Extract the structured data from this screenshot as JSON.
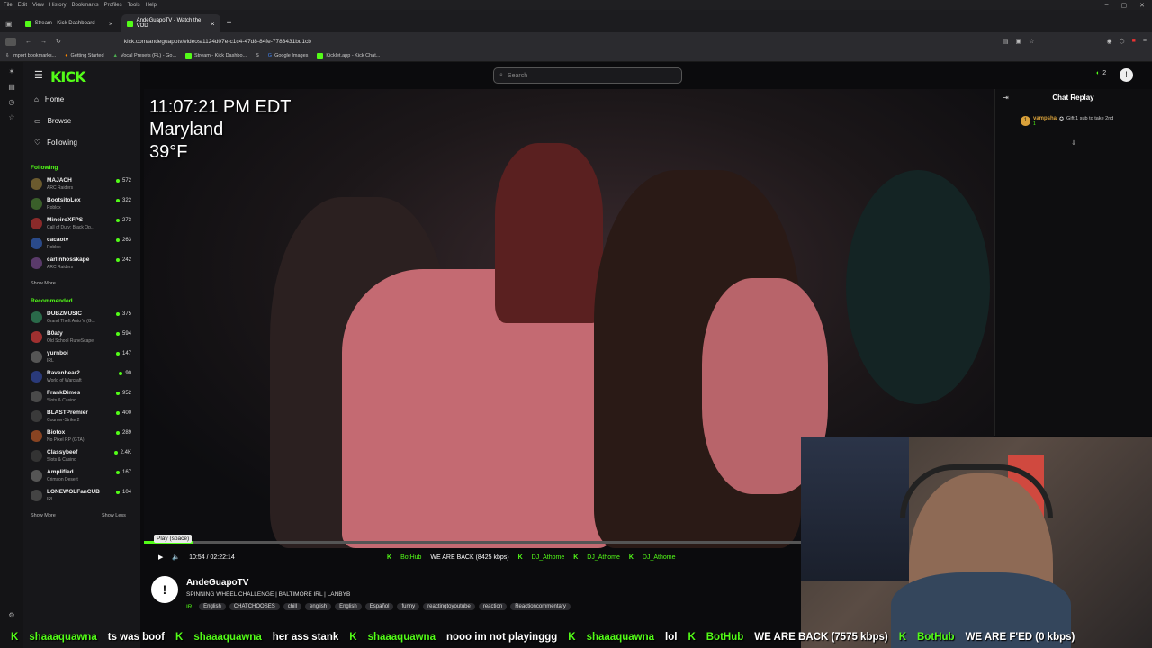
{
  "browser": {
    "menu": [
      "File",
      "Edit",
      "View",
      "History",
      "Bookmarks",
      "Profiles",
      "Tools",
      "Help"
    ],
    "tabs": [
      {
        "label": "Stream - Kick Dashboard"
      },
      {
        "label": "AndeGuapoTV - Watch the VOD"
      }
    ],
    "url": "kick.com/andeguapotv/videos/1124d07e-c1c4-47d8-84fe-7783431bd1cb",
    "bookmarks": [
      "Import bookmarks...",
      "Getting Started",
      "Vocal Presets (FL) - Go...",
      "Stream - Kick Dashbo...",
      "Google Images",
      "Kicklet.app - Kick Chat..."
    ]
  },
  "site": {
    "logo": "KICK",
    "search_placeholder": "Search",
    "notif_count": "2"
  },
  "nav": {
    "home": "Home",
    "browse": "Browse",
    "following": "Following"
  },
  "following": {
    "heading": "Following",
    "channels": [
      {
        "name": "MAJACH",
        "game": "ARC Raiders",
        "viewers": "572"
      },
      {
        "name": "BootsitoLex",
        "game": "Roblox",
        "viewers": "322"
      },
      {
        "name": "MineiroXFPS",
        "game": "Call of Duty: Black Op...",
        "viewers": "273"
      },
      {
        "name": "cacaotv",
        "game": "Roblox",
        "viewers": "263"
      },
      {
        "name": "carlinhosskape",
        "game": "ARC Raiders",
        "viewers": "242"
      }
    ],
    "show_more": "Show More"
  },
  "recommended": {
    "heading": "Recommended",
    "channels": [
      {
        "name": "DUBZMUSIC",
        "game": "Grand Theft Auto V (G...",
        "viewers": "375"
      },
      {
        "name": "B0aty",
        "game": "Old School RuneScape",
        "viewers": "594"
      },
      {
        "name": "yurnboi",
        "game": "IRL",
        "viewers": "147"
      },
      {
        "name": "Ravenbear2",
        "game": "World of Warcraft",
        "viewers": "90"
      },
      {
        "name": "FrankDimes",
        "game": "Slots & Casino",
        "viewers": "952"
      },
      {
        "name": "BLASTPremier",
        "game": "Counter-Strike 2",
        "viewers": "400"
      },
      {
        "name": "Biotox",
        "game": "No Pixel RP (GTA)",
        "viewers": "289"
      },
      {
        "name": "Classybeef",
        "game": "Slots & Casino",
        "viewers": "2.4K"
      },
      {
        "name": "Amplified",
        "game": "Crimson Desert",
        "viewers": "167"
      },
      {
        "name": "LONEWOLFanCUB",
        "game": "IRL",
        "viewers": "104"
      }
    ],
    "show_more": "Show More",
    "show_less": "Show Less"
  },
  "video": {
    "overlay_time": "11:07:21 PM EDT",
    "overlay_location": "Maryland",
    "overlay_temp": "39°F",
    "tooltip": "Play (space)",
    "time": "10:54 / 02:22:14",
    "progress_fraction": 0.076
  },
  "ticker_small": [
    {
      "user": "BotHub",
      "msg": "WE ARE BACK (8425 kbps)"
    },
    {
      "user": "DJ_Athome",
      "msg": ""
    },
    {
      "user": "DJ_Athome",
      "msg": ""
    },
    {
      "user": "DJ_Athome",
      "msg": ""
    }
  ],
  "channel": {
    "name": "AndeGuapoTV",
    "title": "SPINNING WHEEL CHALLENGE | BALTIMORE IRL | LANBYB",
    "category": "IRL",
    "tags": [
      "English",
      "CHATCHOOSES",
      "chill",
      "english",
      "English",
      "Español",
      "funny",
      "reactingtoyoutube",
      "reaction",
      "Reactioncommentary"
    ]
  },
  "chat": {
    "title": "Chat Replay",
    "message": {
      "user": "vampsha",
      "count": "1",
      "text": "Gift 1 sub to take 2nd"
    }
  },
  "ticker_big": [
    {
      "user": "shaaaquawna",
      "msg": "ts was boof"
    },
    {
      "user": "shaaaquawna",
      "msg": "her ass stank"
    },
    {
      "user": "shaaaquawna",
      "msg": "nooo im not playinggg"
    },
    {
      "user": "shaaaquawna",
      "msg": "lol"
    },
    {
      "user": "BotHub",
      "msg": "WE ARE BACK (7575 kbps)"
    },
    {
      "user": "BotHub",
      "msg": "WE ARE F'ED (0 kbps)"
    }
  ],
  "colors": {
    "accent": "#53fc18",
    "background": "#0b0b0d",
    "sidebar": "#17171a"
  }
}
